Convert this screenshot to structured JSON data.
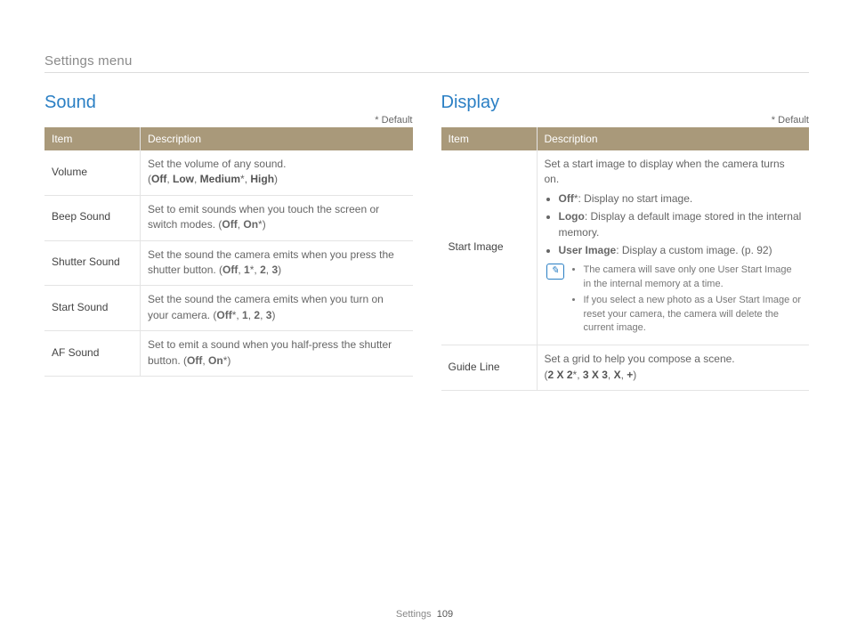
{
  "breadcrumb": "Settings menu",
  "default_label": "* Default",
  "footer": {
    "section": "Settings",
    "page": "109"
  },
  "table_headers": {
    "item": "Item",
    "description": "Description"
  },
  "sound": {
    "title": "Sound",
    "rows": {
      "volume": {
        "item": "Volume",
        "desc": "Set the volume of any sound.",
        "opts_prefix": "(",
        "o1": "Off",
        "c1": ", ",
        "o2": "Low",
        "c2": ", ",
        "o3": "Medium",
        "s3": "*",
        "c3": ", ",
        "o4": "High",
        "opts_suffix": ")"
      },
      "beep": {
        "item": "Beep Sound",
        "desc": "Set to emit sounds when you touch the screen or switch modes. (",
        "o1": "Off",
        "c1": ", ",
        "o2": "On",
        "s2": "*",
        "suffix": ")"
      },
      "shutter": {
        "item": "Shutter Sound",
        "desc": "Set the sound the camera emits when you press the shutter button. (",
        "o1": "Off",
        "c1": ", ",
        "o2": "1",
        "s2": "*",
        "c2": ", ",
        "o3": "2",
        "c3": ", ",
        "o4": "3",
        "suffix": ")"
      },
      "start": {
        "item": "Start Sound",
        "desc": "Set the sound the camera emits when you turn on your camera. (",
        "o1": "Off",
        "s1": "*",
        "c1": ", ",
        "o2": "1",
        "c2": ", ",
        "o3": "2",
        "c3": ", ",
        "o4": "3",
        "suffix": ")"
      },
      "af": {
        "item": "AF Sound",
        "desc": "Set to emit a sound when you half-press the shutter button. (",
        "o1": "Off",
        "c1": ", ",
        "o2": "On",
        "s2": "*",
        "suffix": ")"
      }
    }
  },
  "display": {
    "title": "Display",
    "start_image": {
      "item": "Start Image",
      "intro": "Set a start image to display when the camera turns on.",
      "b1": {
        "label": "Off",
        "star": "*",
        "text": ": Display no start image."
      },
      "b2": {
        "label": "Logo",
        "text": ": Display a default image stored in the internal memory."
      },
      "b3": {
        "label": "User Image",
        "text": ": Display a custom image. (p. 92)"
      },
      "note_icon": "✎",
      "note1": "The camera will save only one User Start Image in the internal memory at a time.",
      "note2": "If you select a new photo as a User Start Image or reset your camera, the camera will delete the current image."
    },
    "guide_line": {
      "item": "Guide Line",
      "desc": "Set a grid to help you compose a scene.",
      "opts_prefix": "(",
      "o1": "2 X 2",
      "s1": "*",
      "c1": ", ",
      "o2": "3 X 3",
      "c2": ", ",
      "o3": "X",
      "c3": ", ",
      "o4": "+",
      "opts_suffix": ")"
    }
  }
}
